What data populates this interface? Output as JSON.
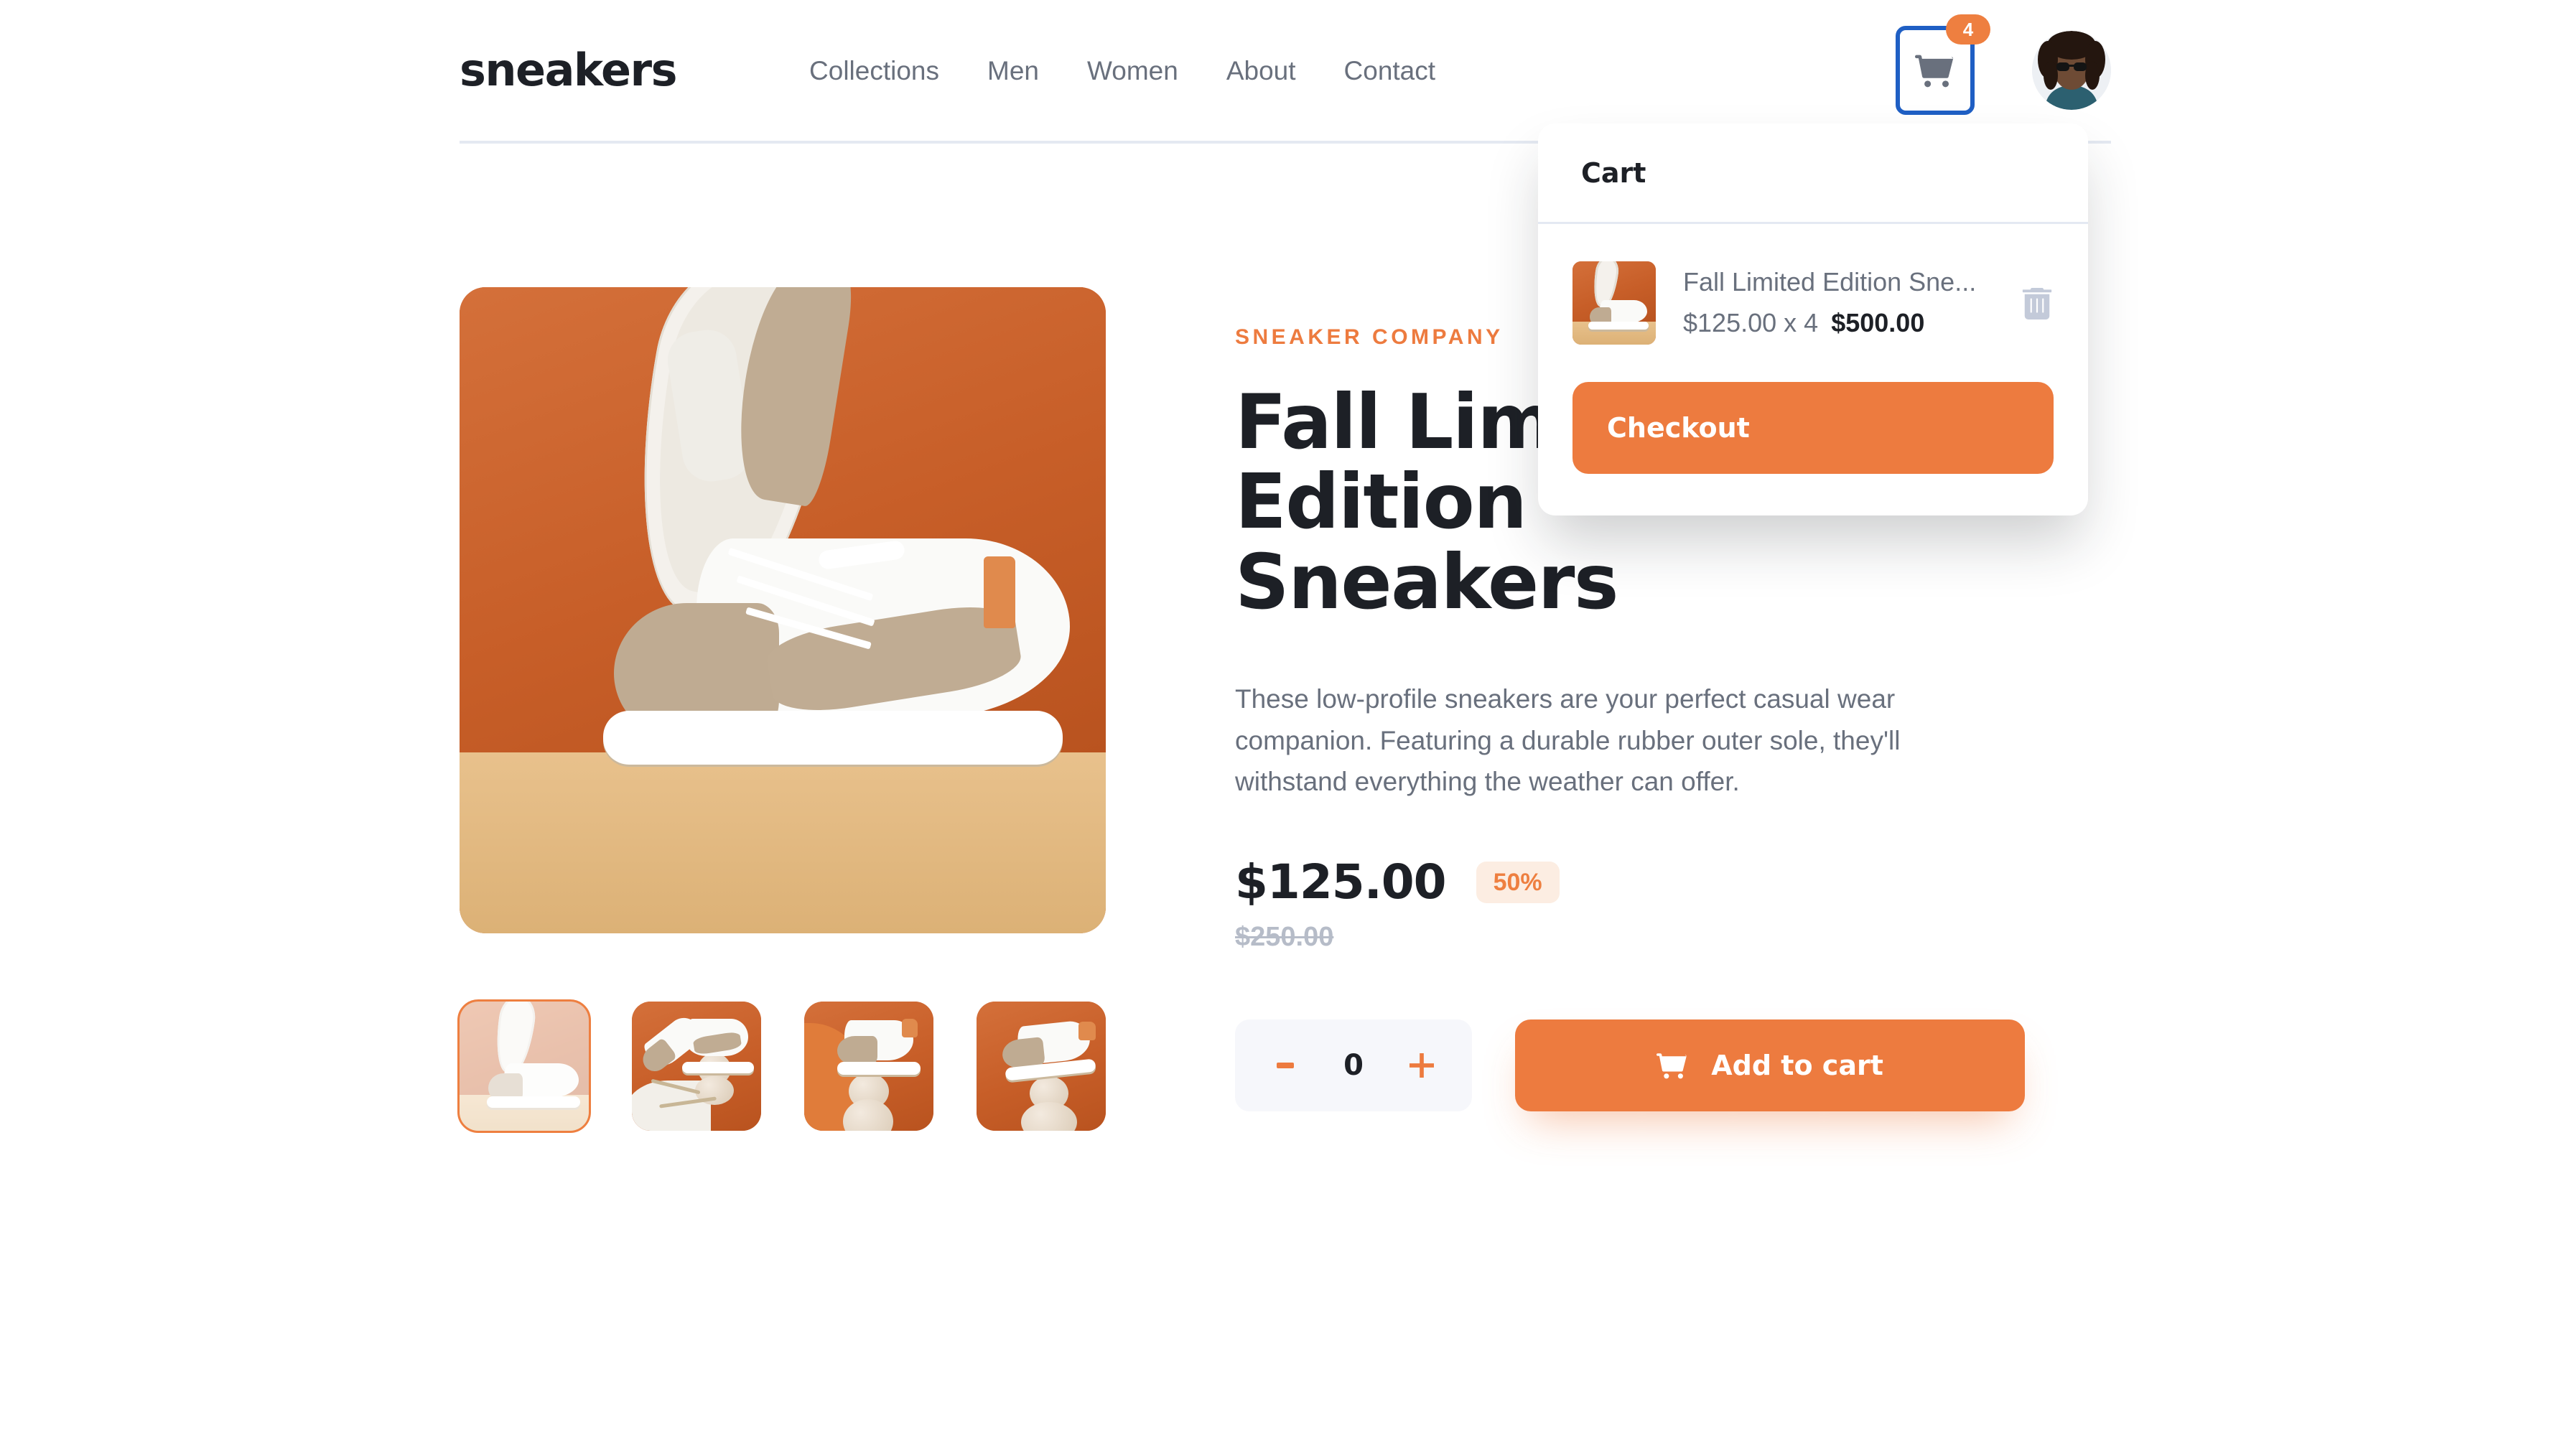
{
  "header": {
    "logo": "sneakers",
    "nav": [
      {
        "label": "Collections"
      },
      {
        "label": "Men"
      },
      {
        "label": "Women"
      },
      {
        "label": "About"
      },
      {
        "label": "Contact"
      }
    ],
    "cart_icon": "shopping-cart-icon",
    "cart_badge_count": "4",
    "avatar_alt": "user-avatar"
  },
  "cart_panel": {
    "title": "Cart",
    "items": [
      {
        "name": "Fall Limited Edition Sne...",
        "unit_price": "$125.00",
        "quantity_label": "x 4",
        "line_total": "$500.00",
        "delete_icon": "trash-icon"
      }
    ],
    "checkout_label": "Checkout"
  },
  "product": {
    "brand": "SNEAKER COMPANY",
    "title": "Fall Limited Edition Sneakers",
    "description": "These low-profile sneakers are your perfect casual wear companion. Featuring a durable rubber outer sole, they'll withstand everything the weather can offer.",
    "price_current": "$125.00",
    "discount": "50%",
    "price_old": "$250.00",
    "quantity": "0",
    "minus_icon": "minus-icon",
    "plus_icon": "plus-icon",
    "add_to_cart_label": "Add to cart",
    "add_to_cart_icon": "cart-icon",
    "thumbnails": [
      {
        "alt": "product-thumbnail-1",
        "active": true
      },
      {
        "alt": "product-thumbnail-2",
        "active": false
      },
      {
        "alt": "product-thumbnail-3",
        "active": false
      },
      {
        "alt": "product-thumbnail-4",
        "active": false
      }
    ]
  },
  "colors": {
    "accent_orange": "#ED7B3F",
    "accent_orange_light": "#FCEDE2",
    "text_dark": "#1D2026",
    "text_gray": "#69707D",
    "text_light_gray": "#B6BCC8",
    "divider": "#E4E9F2",
    "focus_blue": "#1F5FC4",
    "stepper_bg": "#F6F7FB"
  }
}
